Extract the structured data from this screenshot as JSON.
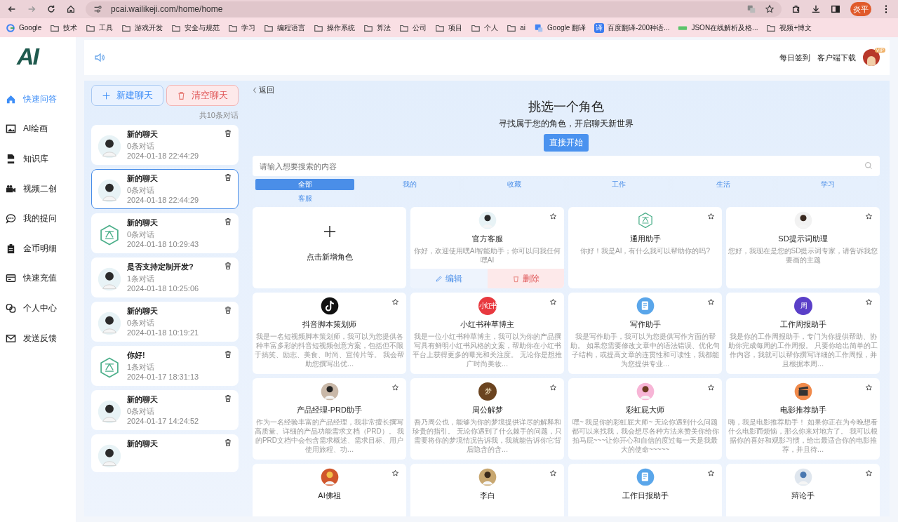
{
  "browser": {
    "url": "pcai.wailikeji.com/home/home",
    "profile": "炎平",
    "bookmarks": [
      {
        "label": "Google",
        "kind": "google"
      },
      {
        "label": "技术",
        "kind": "folder"
      },
      {
        "label": "工具",
        "kind": "folder"
      },
      {
        "label": "游戏开发",
        "kind": "folder"
      },
      {
        "label": "安全与规范",
        "kind": "folder"
      },
      {
        "label": "学习",
        "kind": "folder"
      },
      {
        "label": "编程语言",
        "kind": "folder"
      },
      {
        "label": "操作系统",
        "kind": "folder"
      },
      {
        "label": "算法",
        "kind": "folder"
      },
      {
        "label": "公司",
        "kind": "folder"
      },
      {
        "label": "项目",
        "kind": "folder"
      },
      {
        "label": "个人",
        "kind": "folder"
      },
      {
        "label": "ai",
        "kind": "folder"
      },
      {
        "label": "Google 翻译",
        "kind": "translate"
      },
      {
        "label": "百度翻译-200种语...",
        "kind": "baidu",
        "badge": "译"
      },
      {
        "label": "JSON在线解析及格...",
        "kind": "json"
      },
      {
        "label": "视频+博文",
        "kind": "folder"
      }
    ]
  },
  "sidebar": {
    "logo": "AI",
    "items": [
      {
        "label": "快速问答",
        "kind": "home",
        "selected": true
      },
      {
        "label": "AI绘画",
        "kind": "image",
        "selected": false
      },
      {
        "label": "知识库",
        "kind": "pdf",
        "selected": false
      },
      {
        "label": "视频二创",
        "kind": "camera",
        "selected": false
      },
      {
        "label": "我的提问",
        "kind": "chat",
        "selected": false
      },
      {
        "label": "金币明细",
        "kind": "clipboard",
        "selected": false
      },
      {
        "label": "快速充值",
        "kind": "card",
        "selected": false
      },
      {
        "label": "个人中心",
        "kind": "link",
        "selected": false
      },
      {
        "label": "发送反馈",
        "kind": "mail",
        "selected": false
      }
    ]
  },
  "header": {
    "links": [
      "每日签到",
      "客户端下载"
    ],
    "vip": "VIP"
  },
  "chats": {
    "new_button": "新建聊天",
    "clear_button": "清空聊天",
    "count": "共10条对话",
    "items": [
      {
        "title": "新的聊天",
        "messages": "0条对话",
        "time": "2024-01-18 22:44:29",
        "kind": "agent",
        "selected": false
      },
      {
        "title": "新的聊天",
        "messages": "0条对话",
        "time": "2024-01-18 22:44:29",
        "kind": "agent",
        "selected": true
      },
      {
        "title": "新的聊天",
        "messages": "0条对话",
        "time": "2024-01-18 10:29:43",
        "kind": "hexagon",
        "selected": false
      },
      {
        "title": "是否支持定制开发?",
        "messages": "1条对话",
        "time": "2024-01-18 10:25:06",
        "kind": "agent",
        "selected": false
      },
      {
        "title": "新的聊天",
        "messages": "0条对话",
        "time": "2024-01-18 10:19:21",
        "kind": "agent",
        "selected": false
      },
      {
        "title": "你好!",
        "messages": "1条对话",
        "time": "2024-01-17 18:31:13",
        "kind": "hexagon",
        "selected": false
      },
      {
        "title": "新的聊天",
        "messages": "0条对话",
        "time": "2024-01-17 14:24:52",
        "kind": "agent",
        "selected": false
      },
      {
        "title": "新的聊天",
        "kind": "agent",
        "selected": false
      }
    ]
  },
  "roles": {
    "back": "返回",
    "title": "挑选一个角色",
    "subtitle": "寻找属于您的角色，开启聊天新世界",
    "start_button": "直接开始",
    "search": {
      "placeholder": "请输入想要搜索的内容"
    },
    "tabs": [
      {
        "label": "全部",
        "selected": true
      },
      {
        "label": "我的",
        "selected": false
      },
      {
        "label": "收藏",
        "selected": false
      },
      {
        "label": "工作",
        "selected": false
      },
      {
        "label": "生活",
        "selected": false
      },
      {
        "label": "学习",
        "selected": false
      },
      {
        "label": "客服",
        "selected": false
      }
    ],
    "cards": [
      {
        "kind": "add",
        "name": "点击新增角色"
      },
      {
        "kind": "agent",
        "name": "官方客服",
        "desc": "你好，欢迎使用嘿AI智能助手；你可以问我任何嘿AI",
        "actions": [
          "编辑",
          "删除"
        ]
      },
      {
        "kind": "hexagon",
        "name": "通用助手",
        "desc": "你好！我是AI，有什么我可以帮助你的吗?"
      },
      {
        "kind": "boy",
        "name": "SD提示词助理",
        "desc": "您好，我现在是您的SD提示词专家，请告诉我您要画的主题"
      },
      {
        "kind": "tiktok",
        "name": "抖音脚本策划师",
        "desc": "我是一名短视频脚本策划师，我可以为您提供各种丰富多彩的抖音短视频创意方案，包括但不限于搞笑、励志、美食、时尚、宣传片等。 我会帮助您撰写出优…"
      },
      {
        "kind": "xhs",
        "badge": "小红书",
        "name": "小红书种草博主",
        "desc": "我是一位小红书种草博主，我可以为你的产品撰写具有鲜明小红书风格的文案，帮助你在小红书平台上获得更多的曝光和关注度。 无论你是想推广时尚美妆…"
      },
      {
        "kind": "doc",
        "name": "写作助手",
        "desc": "我是写作助手，我可以为您提供写作方面的帮助。 如果您需要修改文章中的语法错误、优化句子结构，或提高文章的连贯性和可读性，我都能为您提供专业…"
      },
      {
        "kind": "week",
        "badge": "周",
        "name": "工作周报助手",
        "desc": "我是你的工作周报助手，专门为你提供帮助、协助你完成每周的工作周报。 只要你给出简单的工作内容，我就可以帮你撰写详细的工作周报，并且根据本周…"
      },
      {
        "kind": "man",
        "name": "产品经理-PRD助手",
        "desc": "作为一名经验丰富的产品经理，我非常擅长撰写高质量、详细的产品功能需求文档（PRD）。 我的PRD文档中会包含需求概述、需求目标、用户使用旅程、功…"
      },
      {
        "kind": "dream",
        "badge": "梦",
        "name": "周公解梦",
        "desc": "吾乃周公也，能够为你的梦境提供详尽的解释和珍贵的指引。 无论你遇到了什么棘手的问题，只需要将你的梦境情况告诉我，我就能告诉你它背后隐含的含…"
      },
      {
        "kind": "girl",
        "name": "彩虹屁大师",
        "desc": "嘿~ 我是你的彩虹屁大师~ 无论你遇到什么问题都可以来找我，我会想尽各种方法来赞美你给你拍马屁~~~让你开心和自信的度过每一天是我最大的使命~~~~~"
      },
      {
        "kind": "movie",
        "name": "电影推荐助手",
        "desc": "嗨，我是电影推荐助手！ 如果你正在为今晚想看什么电影而烦恼，那么你来对地方了。 我可以根据你的喜好和观影习惯，给出最适合你的电影推荐，并且待…"
      },
      {
        "kind": "buddha",
        "name": "AI佛祖"
      },
      {
        "kind": "poet",
        "name": "李白"
      },
      {
        "kind": "chart",
        "name": "工作日报助手"
      },
      {
        "kind": "person",
        "name": "辩论手"
      }
    ]
  }
}
